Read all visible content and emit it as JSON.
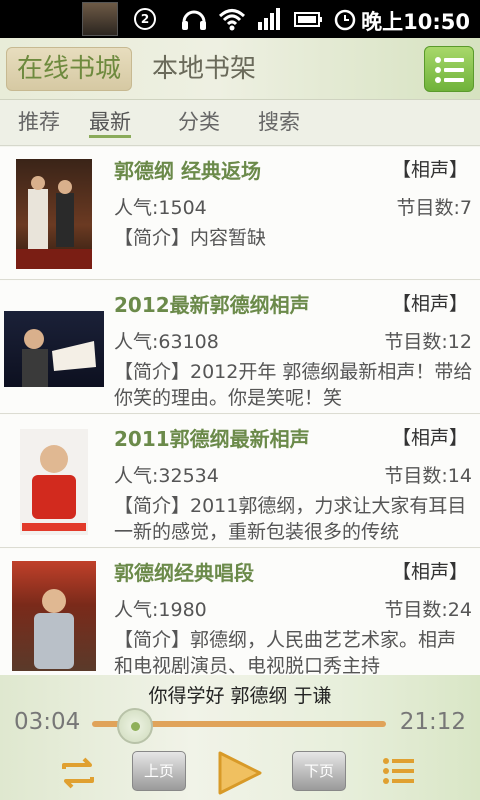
{
  "status_bar": {
    "notification_count": "2",
    "time": "晚上10:50"
  },
  "header": {
    "tab_online": "在线书城",
    "tab_local": "本地书架"
  },
  "subtabs": [
    "推荐",
    "最新",
    "分类",
    "搜索"
  ],
  "list": [
    {
      "title": "郭德纲 经典返场",
      "category": "【相声】",
      "popularity": "人气:1504",
      "episodes": "节目数:7",
      "intro": "【简介】内容暂缺"
    },
    {
      "title": "2012最新郭德纲相声",
      "category": "【相声】",
      "popularity": "人气:63108",
      "episodes": "节目数:12",
      "intro": "【简介】2012开年 郭德纲最新相声！带给你笑的理由。你是笑呢！笑"
    },
    {
      "title": "2011郭德纲最新相声",
      "category": "【相声】",
      "popularity": "人气:32534",
      "episodes": "节目数:14",
      "intro": "【简介】2011郭德纲，力求让大家有耳目一新的感觉，重新包装很多的传统"
    },
    {
      "title": "郭德纲经典唱段",
      "category": "【相声】",
      "popularity": "人气:1980",
      "episodes": "节目数:24",
      "intro": "【简介】郭德纲，人民曲艺艺术家。相声和电视剧演员、电视脱口秀主持"
    }
  ],
  "player": {
    "song": "你得学好 郭德纲 于谦",
    "current_time": "03:04",
    "total_time": "21:12",
    "progress_fraction": 0.145,
    "prev_page": "上页",
    "next_page": "下页"
  },
  "colors": {
    "accent_green": "#6b8a4a",
    "progress_orange": "#e0a35a",
    "menu_button": "#7fbf45"
  }
}
